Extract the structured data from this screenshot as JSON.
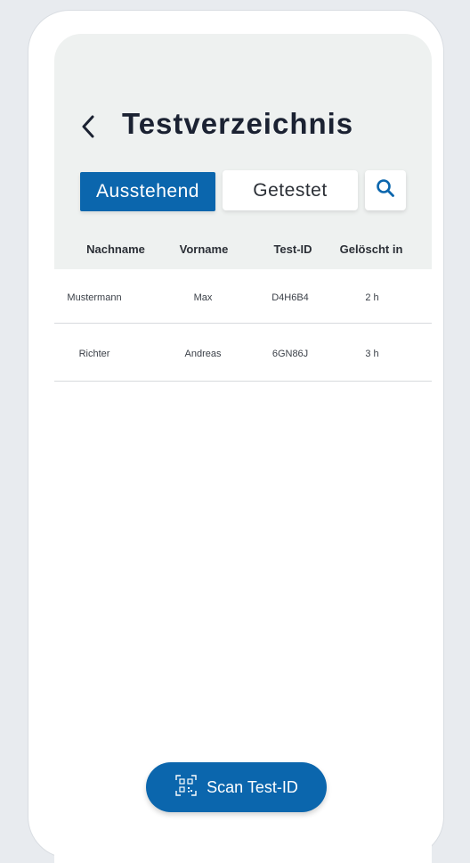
{
  "header": {
    "title": "Testverzeichnis"
  },
  "tabs": [
    {
      "label": "Ausstehend",
      "active": true
    },
    {
      "label": "Getestet",
      "active": false
    }
  ],
  "table": {
    "columns": [
      "Nachname",
      "Vorname",
      "Test-ID",
      "Gelöscht in"
    ],
    "rows": [
      [
        "Mustermann",
        "Max",
        "D4H6B4",
        "2 h"
      ],
      [
        "Richter",
        "Andreas",
        "6GN86J",
        "3 h"
      ]
    ]
  },
  "scan_button": {
    "label": "Scan Test-ID"
  },
  "icons": {
    "back": "back-chevron-icon",
    "search": "search-icon",
    "qr": "qr-code-icon"
  },
  "colors": {
    "accent": "#0b66ad",
    "header_bg": "#eef1f0",
    "text": "#1b2232",
    "background": "#e8ebef"
  }
}
